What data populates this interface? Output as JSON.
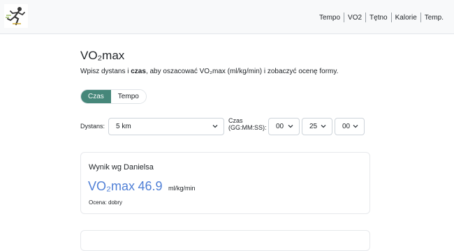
{
  "nav": {
    "items": [
      "Tempo",
      "VO2",
      "Tętno",
      "Kalorie",
      "Temp."
    ]
  },
  "page": {
    "title": "VO₂max",
    "description_pre": "Wpisz dystans i ",
    "description_bold": "czas",
    "description_post": ", aby oszacować VO₂max (ml/kg/min) i zobaczyć ocenę formy."
  },
  "mode_toggle": {
    "options": [
      "Czas",
      "Tempo"
    ],
    "selected": "Czas"
  },
  "form": {
    "distance_label": "Dystans:",
    "distance_value": "5 km",
    "time_label_line1": "Czas",
    "time_label_line2": "(GG:MM:SS):",
    "hours": "00",
    "minutes": "25",
    "seconds": "00"
  },
  "result_card": {
    "title": "Wynik wg Danielsa",
    "metric": "VO₂max",
    "value": "46.9",
    "unit": "ml/kg/min",
    "rating": "Ocena: dobry"
  },
  "colors": {
    "accent_green": "#46877a",
    "result_blue": "#4f7fd6"
  }
}
